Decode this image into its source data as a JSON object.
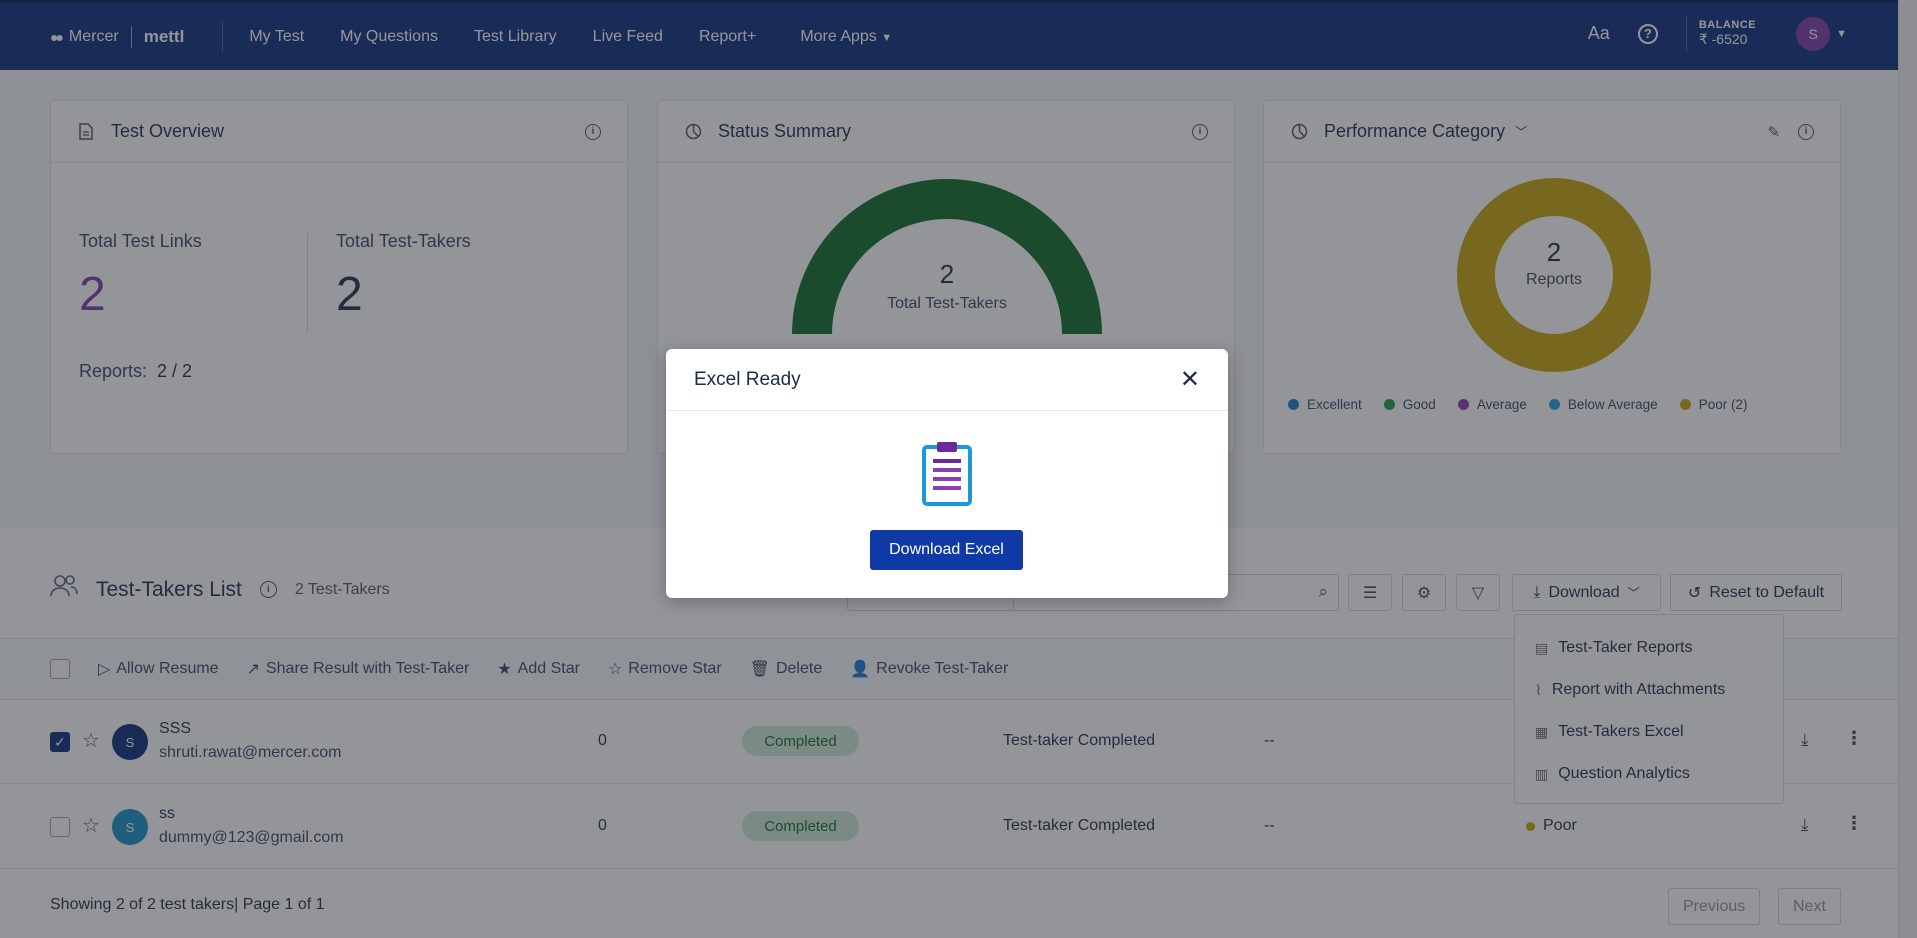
{
  "brand": {
    "mercer": "Mercer",
    "mettl": "mettl"
  },
  "nav": {
    "items": [
      "My Test",
      "My Questions",
      "Test Library",
      "Live Feed",
      "Report+"
    ],
    "more": "More Apps"
  },
  "topright": {
    "font_toggle": "Aa",
    "balance_label": "BALANCE",
    "balance_value": "₹ -6520",
    "avatar_initial": "S"
  },
  "overview": {
    "title": "Test Overview",
    "total_links_label": "Total Test Links",
    "total_links_value": "2",
    "total_takers_label": "Total Test-Takers",
    "total_takers_value": "2",
    "reports_label": "Reports:",
    "reports_value": "2 / 2"
  },
  "status": {
    "title": "Status Summary",
    "center_value": "2",
    "center_label": "Total Test-Takers",
    "arc_color": "#0d6b24"
  },
  "performance": {
    "title": "Performance Category",
    "center_value": "2",
    "center_label": "Reports",
    "ring_color": "#c9a50a",
    "legend": [
      {
        "label": "Excellent",
        "color": "#1f7ac7"
      },
      {
        "label": "Good",
        "color": "#1f9a3e"
      },
      {
        "label": "Average",
        "color": "#8a3fb3"
      },
      {
        "label": "Below Average",
        "color": "#1ea7d6"
      },
      {
        "label": "Poor (2)",
        "color": "#c9a50a"
      }
    ]
  },
  "list": {
    "title": "Test-Takers List",
    "count": "2 Test-Takers",
    "download_label": "Download",
    "reset_label": "Reset to Default",
    "actions": [
      "Allow Resume",
      "Share Result with Test-Taker",
      "Add Star",
      "Remove Star",
      "Delete",
      "Revoke Test-Taker"
    ],
    "rows": [
      {
        "checked": true,
        "initial": "S",
        "avatar_color": "#0a2d7a",
        "name": "SSS",
        "email": "shruti.rawat@mercer.com",
        "score": "0",
        "status": "Completed",
        "stage": "Test-taker Completed",
        "extra": "--",
        "performance": ""
      },
      {
        "checked": false,
        "initial": "S",
        "avatar_color": "#1990c8",
        "name": "ss",
        "email": "dummy@123@gmail.com",
        "score": "0",
        "status": "Completed",
        "stage": "Test-taker Completed",
        "extra": "--",
        "performance": "Poor"
      }
    ]
  },
  "dropdown": {
    "items": [
      "Test-Taker Reports",
      "Report with Attachments",
      "Test-Takers Excel",
      "Question Analytics"
    ]
  },
  "footer": {
    "showing": "Showing 2 of 2 test takers| Page 1 of 1",
    "prev": "Previous",
    "next": "Next"
  },
  "modal": {
    "title": "Excel Ready",
    "button": "Download Excel"
  }
}
